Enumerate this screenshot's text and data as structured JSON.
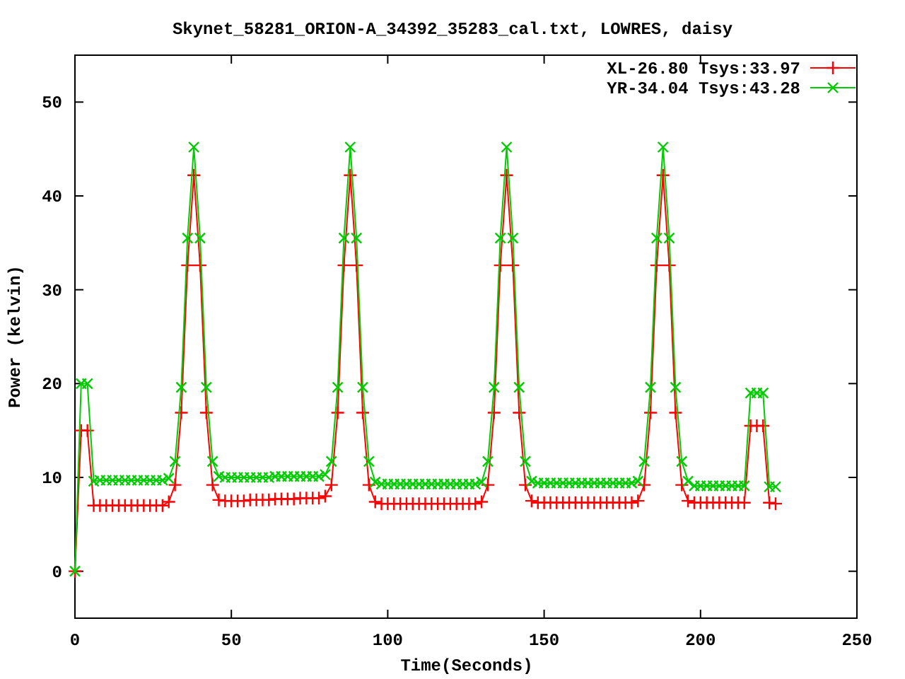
{
  "chart_data": {
    "type": "line",
    "title": "Skynet_58281_ORION-A_34392_35283_cal.txt, LOWRES, daisy",
    "xlabel": "Time(Seconds)",
    "ylabel": "Power (kelvin)",
    "legend": true,
    "xlim": [
      0,
      250
    ],
    "ylim": [
      -5,
      55
    ],
    "xticks": [
      0,
      50,
      100,
      150,
      200,
      250
    ],
    "yticks": [
      0,
      10,
      20,
      30,
      40,
      50
    ],
    "x": [
      0,
      2,
      4,
      6,
      8,
      10,
      12,
      14,
      16,
      18,
      20,
      22,
      24,
      26,
      28,
      30,
      32,
      34,
      36,
      38,
      40,
      42,
      44,
      46,
      48,
      50,
      52,
      54,
      56,
      58,
      60,
      62,
      64,
      66,
      68,
      70,
      72,
      74,
      76,
      78,
      80,
      82,
      84,
      86,
      88,
      90,
      92,
      94,
      96,
      98,
      100,
      102,
      104,
      106,
      108,
      110,
      112,
      114,
      116,
      118,
      120,
      122,
      124,
      126,
      128,
      130,
      132,
      134,
      136,
      138,
      140,
      142,
      144,
      146,
      148,
      150,
      152,
      154,
      156,
      158,
      160,
      162,
      164,
      166,
      168,
      170,
      172,
      174,
      176,
      178,
      180,
      182,
      184,
      186,
      188,
      190,
      192,
      194,
      196,
      198,
      200,
      202,
      204,
      206,
      208,
      210,
      212,
      214,
      216,
      218,
      220,
      222,
      224
    ],
    "series": [
      {
        "name": "XL-26.80 Tsys:33.97",
        "color": "#ff0000",
        "marker": "plus",
        "values": [
          0,
          15,
          15,
          7,
          7,
          7,
          7,
          7,
          7,
          7,
          7,
          7,
          7,
          7,
          7,
          7.4,
          9.2,
          16.9,
          32.6,
          42.2,
          32.6,
          16.9,
          9.2,
          7.6,
          7.5,
          7.5,
          7.5,
          7.5,
          7.6,
          7.6,
          7.6,
          7.6,
          7.7,
          7.7,
          7.7,
          7.7,
          7.8,
          7.8,
          7.8,
          7.8,
          8.0,
          9.2,
          16.9,
          32.6,
          42.2,
          32.6,
          16.9,
          9.2,
          7.4,
          7.2,
          7.2,
          7.2,
          7.2,
          7.2,
          7.2,
          7.2,
          7.2,
          7.2,
          7.2,
          7.2,
          7.2,
          7.2,
          7.2,
          7.2,
          7.2,
          7.4,
          9.2,
          16.9,
          32.6,
          42.2,
          32.6,
          16.9,
          9.2,
          7.5,
          7.3,
          7.3,
          7.3,
          7.3,
          7.3,
          7.3,
          7.3,
          7.3,
          7.3,
          7.3,
          7.3,
          7.3,
          7.3,
          7.3,
          7.3,
          7.3,
          7.5,
          9.2,
          16.9,
          32.6,
          42.2,
          32.6,
          16.9,
          9.2,
          7.5,
          7.3,
          7.3,
          7.3,
          7.3,
          7.3,
          7.3,
          7.3,
          7.3,
          7.3,
          15.5,
          15.5,
          15.5,
          7.3,
          7.2
        ]
      },
      {
        "name": "YR-34.04 Tsys:43.28",
        "color": "#00cc00",
        "marker": "cross",
        "values": [
          0,
          20,
          20,
          9.6,
          9.7,
          9.7,
          9.7,
          9.7,
          9.7,
          9.7,
          9.7,
          9.7,
          9.7,
          9.7,
          9.7,
          9.9,
          11.7,
          19.6,
          35.5,
          45.2,
          35.5,
          19.6,
          11.7,
          10.1,
          10.0,
          10.0,
          10.0,
          10.0,
          10.0,
          10.0,
          10.0,
          10.0,
          10.1,
          10.1,
          10.1,
          10.1,
          10.1,
          10.1,
          10.1,
          10.1,
          10.3,
          11.7,
          19.6,
          35.5,
          45.2,
          35.5,
          19.6,
          11.7,
          9.5,
          9.3,
          9.3,
          9.3,
          9.3,
          9.3,
          9.3,
          9.3,
          9.3,
          9.3,
          9.3,
          9.3,
          9.3,
          9.3,
          9.3,
          9.3,
          9.3,
          9.5,
          11.7,
          19.6,
          35.5,
          45.2,
          35.5,
          19.6,
          11.7,
          9.6,
          9.4,
          9.4,
          9.4,
          9.4,
          9.4,
          9.4,
          9.4,
          9.4,
          9.4,
          9.4,
          9.4,
          9.4,
          9.4,
          9.4,
          9.4,
          9.4,
          9.6,
          11.7,
          19.6,
          35.5,
          45.2,
          35.5,
          19.6,
          11.7,
          9.6,
          9.1,
          9.1,
          9.1,
          9.1,
          9.1,
          9.1,
          9.1,
          9.1,
          9.1,
          19,
          19,
          19,
          9,
          9
        ]
      }
    ]
  }
}
